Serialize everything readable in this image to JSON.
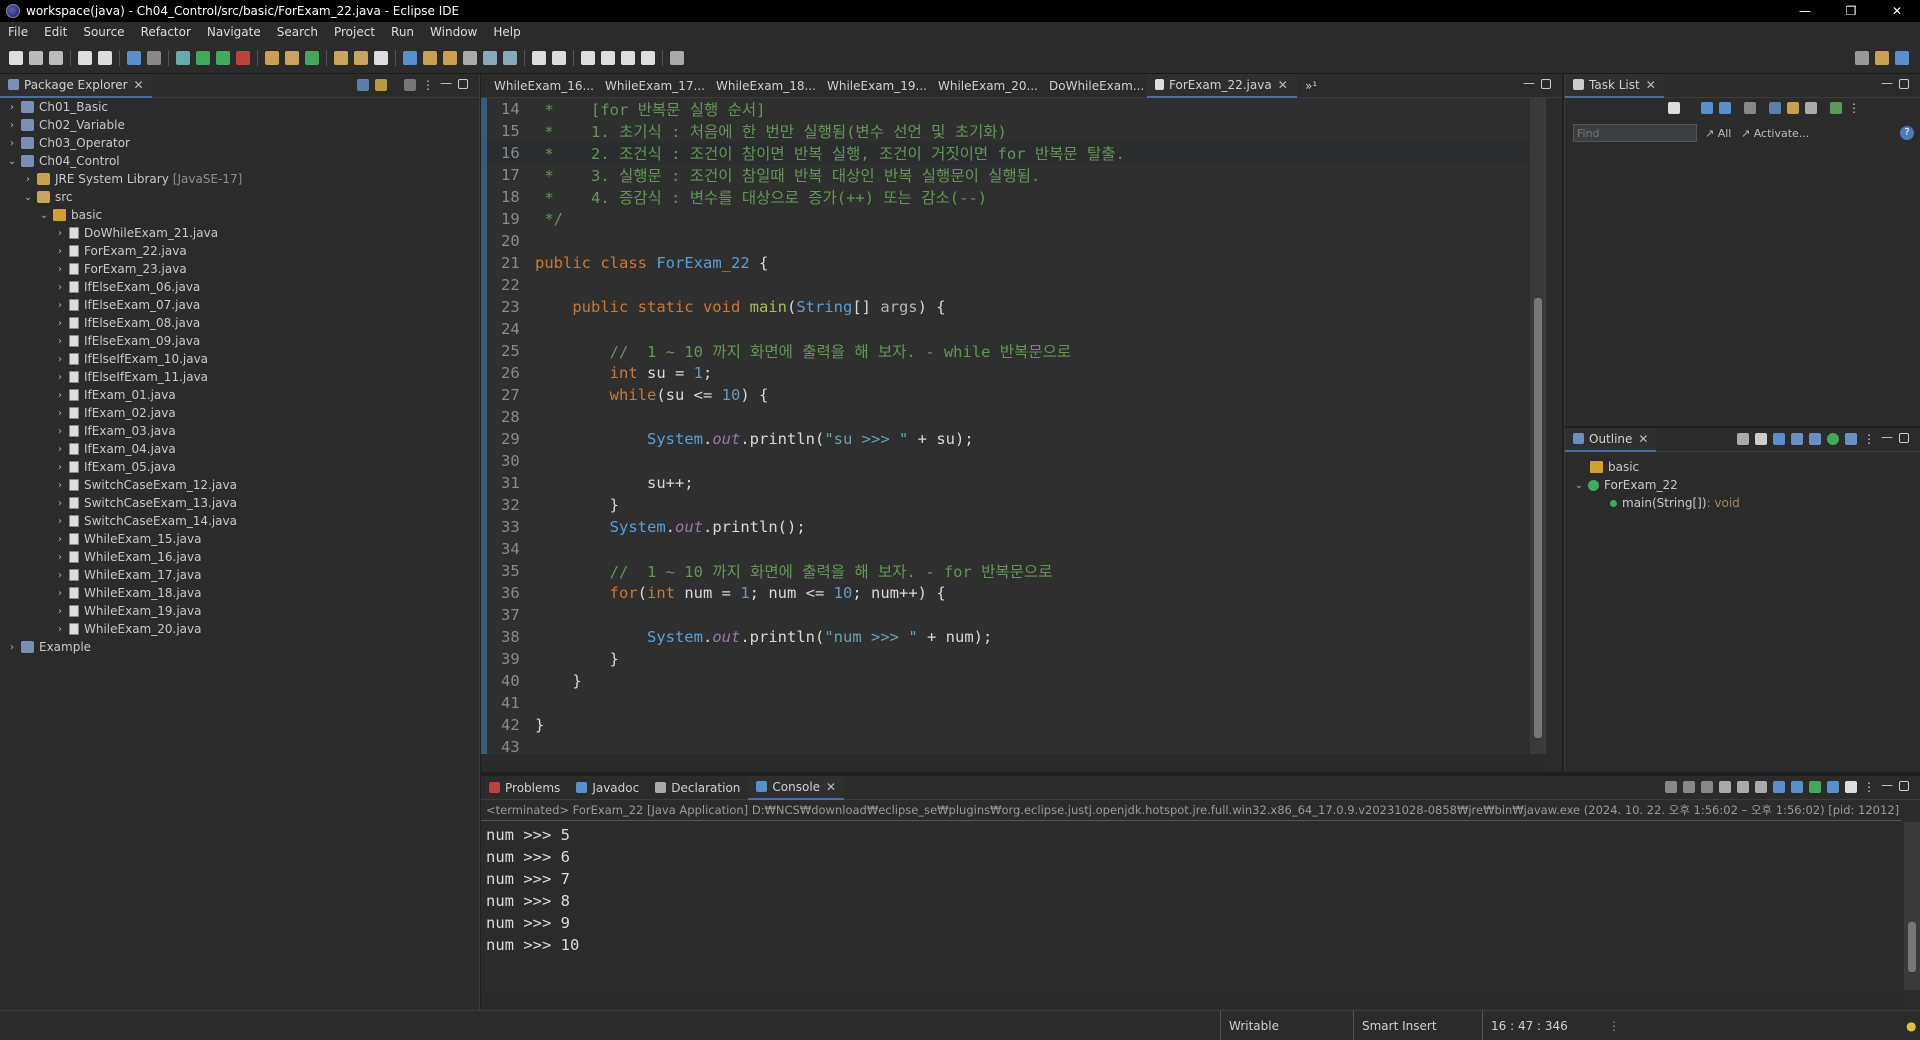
{
  "window": {
    "title": "workspace(java) - Ch04_Control/src/basic/ForExam_22.java - Eclipse IDE",
    "minimize": "—",
    "maximize": "❐",
    "close": "✕"
  },
  "menu": [
    "File",
    "Edit",
    "Source",
    "Refactor",
    "Navigate",
    "Search",
    "Project",
    "Run",
    "Window",
    "Help"
  ],
  "package_explorer": {
    "title": "Package Explorer",
    "items": [
      {
        "depth": 0,
        "arrow": "›",
        "icon": "proj",
        "label": "Ch01_Basic",
        "extra": ""
      },
      {
        "depth": 0,
        "arrow": "›",
        "icon": "proj",
        "label": "Ch02_Variable",
        "extra": ""
      },
      {
        "depth": 0,
        "arrow": "›",
        "icon": "proj",
        "label": "Ch03_Operator",
        "extra": ""
      },
      {
        "depth": 0,
        "arrow": "⌄",
        "icon": "proj",
        "label": "Ch04_Control",
        "extra": ""
      },
      {
        "depth": 1,
        "arrow": "›",
        "icon": "jre",
        "label": "JRE System Library",
        "extra": "[JavaSE-17]"
      },
      {
        "depth": 1,
        "arrow": "⌄",
        "icon": "src",
        "label": "src",
        "extra": ""
      },
      {
        "depth": 2,
        "arrow": "⌄",
        "icon": "pkg",
        "label": "basic",
        "extra": ""
      },
      {
        "depth": 3,
        "arrow": "›",
        "icon": "file",
        "label": "DoWhileExam_21.java",
        "extra": ""
      },
      {
        "depth": 3,
        "arrow": "›",
        "icon": "file",
        "label": "ForExam_22.java",
        "extra": ""
      },
      {
        "depth": 3,
        "arrow": "›",
        "icon": "file",
        "label": "ForExam_23.java",
        "extra": ""
      },
      {
        "depth": 3,
        "arrow": "›",
        "icon": "file",
        "label": "IfElseExam_06.java",
        "extra": ""
      },
      {
        "depth": 3,
        "arrow": "›",
        "icon": "file",
        "label": "IfElseExam_07.java",
        "extra": ""
      },
      {
        "depth": 3,
        "arrow": "›",
        "icon": "file",
        "label": "IfElseExam_08.java",
        "extra": ""
      },
      {
        "depth": 3,
        "arrow": "›",
        "icon": "file",
        "label": "IfElseExam_09.java",
        "extra": ""
      },
      {
        "depth": 3,
        "arrow": "›",
        "icon": "file",
        "label": "IfElseIfExam_10.java",
        "extra": ""
      },
      {
        "depth": 3,
        "arrow": "›",
        "icon": "file",
        "label": "IfElseIfExam_11.java",
        "extra": ""
      },
      {
        "depth": 3,
        "arrow": "›",
        "icon": "file",
        "label": "IfExam_01.java",
        "extra": ""
      },
      {
        "depth": 3,
        "arrow": "›",
        "icon": "file",
        "label": "IfExam_02.java",
        "extra": ""
      },
      {
        "depth": 3,
        "arrow": "›",
        "icon": "file",
        "label": "IfExam_03.java",
        "extra": ""
      },
      {
        "depth": 3,
        "arrow": "›",
        "icon": "file",
        "label": "IfExam_04.java",
        "extra": ""
      },
      {
        "depth": 3,
        "arrow": "›",
        "icon": "file",
        "label": "IfExam_05.java",
        "extra": ""
      },
      {
        "depth": 3,
        "arrow": "›",
        "icon": "file",
        "label": "SwitchCaseExam_12.java",
        "extra": ""
      },
      {
        "depth": 3,
        "arrow": "›",
        "icon": "file",
        "label": "SwitchCaseExam_13.java",
        "extra": ""
      },
      {
        "depth": 3,
        "arrow": "›",
        "icon": "file",
        "label": "SwitchCaseExam_14.java",
        "extra": ""
      },
      {
        "depth": 3,
        "arrow": "›",
        "icon": "file",
        "label": "WhileExam_15.java",
        "extra": ""
      },
      {
        "depth": 3,
        "arrow": "›",
        "icon": "file",
        "label": "WhileExam_16.java",
        "extra": ""
      },
      {
        "depth": 3,
        "arrow": "›",
        "icon": "file",
        "label": "WhileExam_17.java",
        "extra": ""
      },
      {
        "depth": 3,
        "arrow": "›",
        "icon": "file",
        "label": "WhileExam_18.java",
        "extra": ""
      },
      {
        "depth": 3,
        "arrow": "›",
        "icon": "file",
        "label": "WhileExam_19.java",
        "extra": ""
      },
      {
        "depth": 3,
        "arrow": "›",
        "icon": "file",
        "label": "WhileExam_20.java",
        "extra": ""
      },
      {
        "depth": 0,
        "arrow": "›",
        "icon": "proj",
        "label": "Example",
        "extra": ""
      }
    ]
  },
  "editor": {
    "tabs": [
      {
        "label": "WhileExam_16...",
        "active": false
      },
      {
        "label": "WhileExam_17...",
        "active": false
      },
      {
        "label": "WhileExam_18...",
        "active": false
      },
      {
        "label": "WhileExam_19...",
        "active": false
      },
      {
        "label": "WhileExam_20...",
        "active": false
      },
      {
        "label": "DoWhileExam...",
        "active": false
      },
      {
        "label": "ForExam_22.java",
        "active": true
      }
    ],
    "overflow": "»¹",
    "current_line": 16,
    "lines": [
      [
        {
          "c": "cm",
          "t": " *    [for 반복문 실행 순서]"
        }
      ],
      [
        {
          "c": "cm",
          "t": " *    1. 초기식 : 처음에 한 번만 실행됨(변수 선언 및 초기화)"
        }
      ],
      [
        {
          "c": "cm",
          "t": " *    2. 조건식 : 조건이 참이면 반복 실행, 조건이 거짓이면 for 반복문 탈출."
        }
      ],
      [
        {
          "c": "cm",
          "t": " *    3. 실행문 : 조건이 참일때 반복 대상인 반복 실행문이 실행됨."
        }
      ],
      [
        {
          "c": "cm",
          "t": " *    4. 증감식 : 변수를 대상으로 증가(++) 또는 감소(--)"
        }
      ],
      [
        {
          "c": "cm",
          "t": " */"
        }
      ],
      [],
      [
        {
          "c": "k",
          "t": "public class "
        },
        {
          "c": "cls",
          "t": "ForExam_22"
        },
        {
          "c": "",
          "t": " {"
        }
      ],
      [],
      [
        {
          "c": "",
          "t": "    "
        },
        {
          "c": "k",
          "t": "public static void "
        },
        {
          "c": "fn",
          "t": "main"
        },
        {
          "c": "",
          "t": "("
        },
        {
          "c": "cls",
          "t": "String"
        },
        {
          "c": "",
          "t": "[] "
        },
        {
          "c": "pm",
          "t": "args"
        },
        {
          "c": "",
          "t": ") {"
        }
      ],
      [],
      [
        {
          "c": "",
          "t": "        "
        },
        {
          "c": "cm",
          "t": "//  1 ~ 10 까지 화면에 출력을 해 보자. - while 반복문으로"
        }
      ],
      [
        {
          "c": "",
          "t": "        "
        },
        {
          "c": "k",
          "t": "int "
        },
        {
          "c": "",
          "t": "su = "
        },
        {
          "c": "num",
          "t": "1"
        },
        {
          "c": "",
          "t": ";"
        }
      ],
      [
        {
          "c": "",
          "t": "        "
        },
        {
          "c": "k",
          "t": "while"
        },
        {
          "c": "",
          "t": "(su <= "
        },
        {
          "c": "num",
          "t": "10"
        },
        {
          "c": "",
          "t": ") {"
        }
      ],
      [],
      [
        {
          "c": "",
          "t": "            "
        },
        {
          "c": "cls",
          "t": "System"
        },
        {
          "c": "",
          "t": "."
        },
        {
          "c": "fld",
          "t": "out"
        },
        {
          "c": "",
          "t": ".println("
        },
        {
          "c": "st",
          "t": "\"su >>> \""
        },
        {
          "c": "",
          "t": " + su);"
        }
      ],
      [],
      [
        {
          "c": "",
          "t": "            su++;"
        }
      ],
      [
        {
          "c": "",
          "t": "        }"
        }
      ],
      [
        {
          "c": "",
          "t": "        "
        },
        {
          "c": "cls",
          "t": "System"
        },
        {
          "c": "",
          "t": "."
        },
        {
          "c": "fld",
          "t": "out"
        },
        {
          "c": "",
          "t": ".println();"
        }
      ],
      [],
      [
        {
          "c": "",
          "t": "        "
        },
        {
          "c": "cm",
          "t": "//  1 ~ 10 까지 화면에 출력을 해 보자. - for 반복문으로"
        }
      ],
      [
        {
          "c": "",
          "t": "        "
        },
        {
          "c": "k",
          "t": "for"
        },
        {
          "c": "",
          "t": "("
        },
        {
          "c": "k",
          "t": "int "
        },
        {
          "c": "",
          "t": "num = "
        },
        {
          "c": "num",
          "t": "1"
        },
        {
          "c": "",
          "t": "; num <= "
        },
        {
          "c": "num",
          "t": "10"
        },
        {
          "c": "",
          "t": "; num++) {"
        }
      ],
      [],
      [
        {
          "c": "",
          "t": "            "
        },
        {
          "c": "cls",
          "t": "System"
        },
        {
          "c": "",
          "t": "."
        },
        {
          "c": "fld",
          "t": "out"
        },
        {
          "c": "",
          "t": ".println("
        },
        {
          "c": "st",
          "t": "\"num >>> \""
        },
        {
          "c": "",
          "t": " + num);"
        }
      ],
      [
        {
          "c": "",
          "t": "        }"
        }
      ],
      [
        {
          "c": "",
          "t": "    }"
        }
      ],
      [],
      [
        {
          "c": "",
          "t": "}"
        }
      ],
      []
    ],
    "first_line_number": 14
  },
  "task_list": {
    "title": "Task List",
    "find_placeholder": "Find",
    "all": "All",
    "activate": "Activate..."
  },
  "outline": {
    "title": "Outline",
    "items": [
      {
        "label": "basic",
        "detail": ""
      },
      {
        "label": "ForExam_22",
        "detail": ""
      },
      {
        "label": "main(String[])",
        "detail": " : void"
      }
    ]
  },
  "bottom": {
    "tabs": [
      {
        "label": "Problems",
        "active": false
      },
      {
        "label": "Javadoc",
        "active": false
      },
      {
        "label": "Declaration",
        "active": false
      },
      {
        "label": "Console",
        "active": true
      }
    ],
    "terminated": "<terminated> ForExam_22 [Java Application] D:₩NCS₩download₩eclipse_se₩plugins₩org.eclipse.justj.openjdk.hotspot.jre.full.win32.x86_64_17.0.9.v20231028-0858₩jre₩bin₩javaw.exe  (2024. 10. 22. 오후 1:56:02 – 오후 1:56:02) [pid: 12012]",
    "output": [
      "num >>> 5",
      "num >>> 6",
      "num >>> 7",
      "num >>> 8",
      "num >>> 9",
      "num >>> 10"
    ]
  },
  "status": {
    "writable": "Writable",
    "insert": "Smart Insert",
    "position": "16 : 47 : 346"
  },
  "colors": {
    "keyword": "#cc7832",
    "comment": "#629755",
    "class": "#5c9ed6",
    "method": "#a8c04a",
    "string": "#6a9fb5",
    "number": "#6897bb",
    "field": "#9876aa"
  }
}
